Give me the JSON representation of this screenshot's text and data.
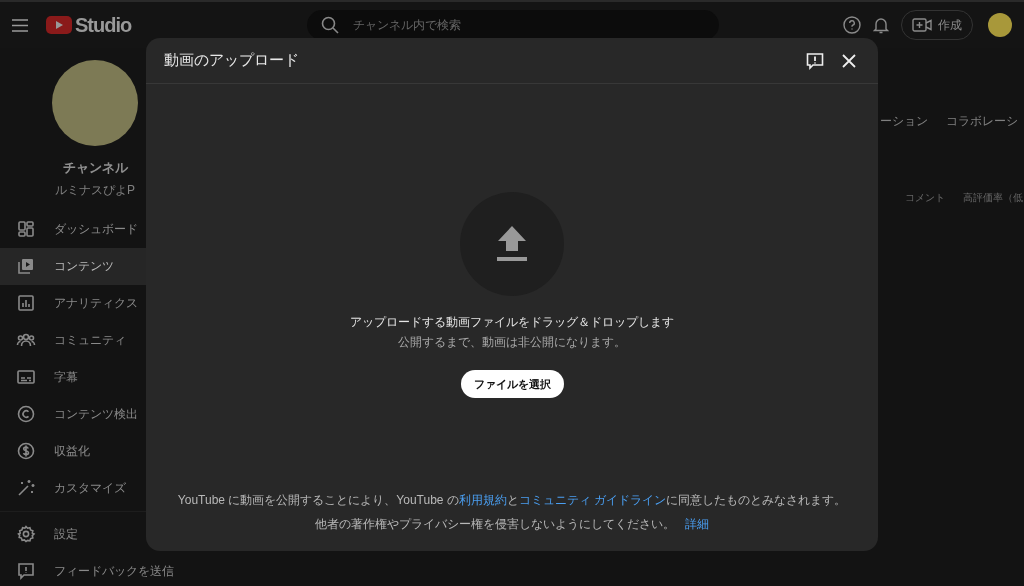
{
  "header": {
    "logo_text": "Studio",
    "search": {
      "placeholder": "チャンネル内で検索"
    },
    "create_button": "作成"
  },
  "sidebar": {
    "channel_title": "チャンネル",
    "channel_name": "ルミナスぴよP",
    "items": [
      {
        "label": "ダッシュボード",
        "selected": false
      },
      {
        "label": "コンテンツ",
        "selected": true
      },
      {
        "label": "アナリティクス",
        "selected": false
      },
      {
        "label": "コミュニティ",
        "selected": false
      },
      {
        "label": "字幕",
        "selected": false
      },
      {
        "label": "コンテンツ検出",
        "selected": false
      },
      {
        "label": "収益化",
        "selected": false
      },
      {
        "label": "カスタマイズ",
        "selected": false
      }
    ],
    "bottom_items": [
      {
        "label": "設定"
      },
      {
        "label": "フィードバックを送信"
      }
    ]
  },
  "background": {
    "tabs": [
      "ーション",
      "コラボレーシ"
    ],
    "columns": [
      "コメント",
      "高評価率（低"
    ]
  },
  "dialog": {
    "title": "動画のアップロード",
    "drop_title": "アップロードする動画ファイルをドラッグ＆ドロップします",
    "drop_subtitle": "公開するまで、動画は非公開になります。",
    "select_button": "ファイルを選択",
    "footer_line1": [
      {
        "kind": "text",
        "text": "YouTube に動画を公開することにより、YouTube の"
      },
      {
        "kind": "link",
        "text": "利用規約"
      },
      {
        "kind": "text",
        "text": "と"
      },
      {
        "kind": "link",
        "text": "コミュニティ ガイドライン"
      },
      {
        "kind": "text",
        "text": "に同意したものとみなされます。"
      }
    ],
    "footer_line2": [
      {
        "kind": "text",
        "text": "他者の著作権やプライバシー権を侵害しないようにしてください。"
      },
      {
        "kind": "link",
        "text": "詳細"
      }
    ]
  }
}
